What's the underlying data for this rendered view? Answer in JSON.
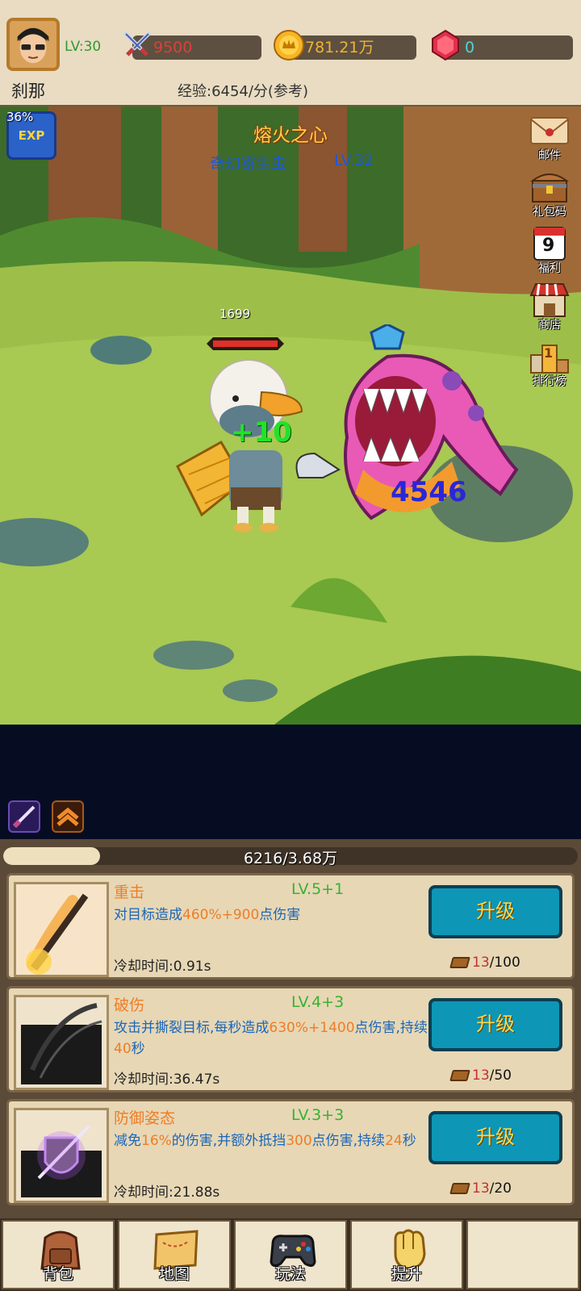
{
  "player": {
    "name": "刹那",
    "level": "LV:30",
    "power": "9500",
    "gold": "781.21万",
    "gems": "0",
    "exp_rate": "经验:6454/分(参考)"
  },
  "scene": {
    "stage_name": "熔火之心",
    "monster_name": "奇幻寄生虫",
    "monster_level": "LV.32",
    "exp_boost_pct": "36%",
    "exp_badge": "EXP",
    "player_hp": "1699",
    "heal_popup": "+10",
    "damage_popup": "4546"
  },
  "side_menu": [
    {
      "label": "邮件",
      "icon": "envelope-icon"
    },
    {
      "label": "礼包码",
      "icon": "treasure-chest-icon"
    },
    {
      "label": "福利",
      "icon": "calendar-icon",
      "badge": "9"
    },
    {
      "label": "商店",
      "icon": "shop-icon"
    },
    {
      "label": "排行榜",
      "icon": "podium-icon",
      "badge": "1"
    }
  ],
  "progress": {
    "text": "6216/3.68万",
    "fraction": 0.169
  },
  "skills": [
    {
      "name": "重击",
      "level": "LV.5+1",
      "desc_parts": [
        "对目标造成",
        "460%+900",
        "点伤害"
      ],
      "cooldown": "冷却时间:0.91s",
      "button": "升级",
      "have": "13",
      "need": "/100"
    },
    {
      "name": "破伤",
      "level": "LV.4+3",
      "desc_parts": [
        "攻击并撕裂目标,每秒造成",
        "630%+1400",
        "点伤害,持续",
        "40",
        "秒"
      ],
      "cooldown": "冷却时间:36.47s",
      "button": "升级",
      "have": "13",
      "need": "/50"
    },
    {
      "name": "防御姿态",
      "level": "LV.3+3",
      "desc_parts": [
        "减免",
        "16%",
        "的伤害,并额外抵挡",
        "300",
        "点伤害,持续",
        "24",
        "秒"
      ],
      "cooldown": "冷却时间:21.88s",
      "button": "升级",
      "have": "13",
      "need": "/20"
    }
  ],
  "nav": [
    {
      "label": "背包",
      "icon": "backpack-icon"
    },
    {
      "label": "地图",
      "icon": "map-scroll-icon"
    },
    {
      "label": "玩法",
      "icon": "gamepad-icon"
    },
    {
      "label": "提升",
      "icon": "fist-icon"
    },
    {
      "label": "",
      "icon": ""
    }
  ],
  "colors": {
    "gold": "#f0b332",
    "power": "#d9413a",
    "gem": "#4fd3d8",
    "upgrade_btn": "#0e96b6",
    "skill_name": "#ee7d26",
    "skill_level": "#38b132",
    "skill_desc": "#1b66b8"
  }
}
